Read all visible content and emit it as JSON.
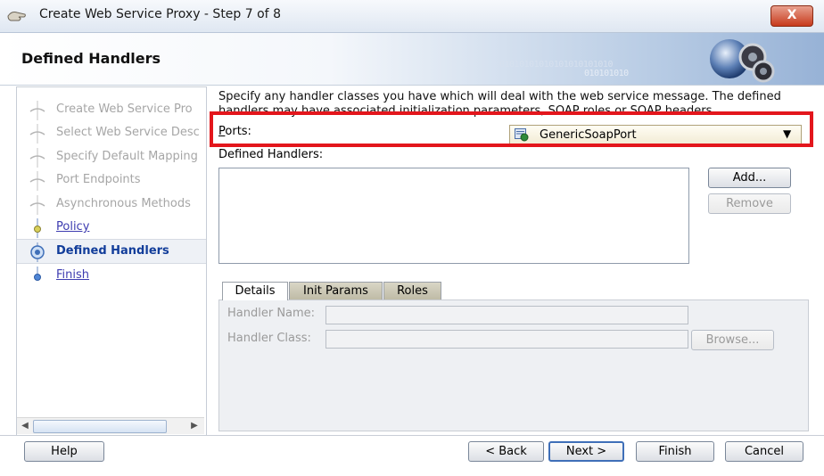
{
  "window": {
    "title": "Create Web Service Proxy - Step 7 of 8",
    "close_label": "X"
  },
  "header": {
    "title": "Defined Handlers",
    "decor_binary_1": "01010101010101010101010",
    "decor_binary_2": "010101010"
  },
  "steps": [
    {
      "label": "Create Web Service Pro",
      "state": "done"
    },
    {
      "label": "Select Web Service Desc",
      "state": "done"
    },
    {
      "label": "Specify Default Mapping",
      "state": "done"
    },
    {
      "label": "Port Endpoints",
      "state": "done"
    },
    {
      "label": "Asynchronous Methods",
      "state": "done"
    },
    {
      "label": "Policy",
      "state": "link"
    },
    {
      "label": "Defined Handlers",
      "state": "current"
    },
    {
      "label": "Finish",
      "state": "link"
    }
  ],
  "main": {
    "instructions": "Specify any handler classes you have which will deal with the web service message. The defined handlers may have associated initialization parameters, SOAP roles or SOAP headers.",
    "ports_label": "Ports:",
    "ports_value": "GenericSoapPort",
    "handlers_label": "Defined Handlers:",
    "add_label": "Add...",
    "remove_label": "Remove"
  },
  "tabs": [
    {
      "label": "Details",
      "active": true
    },
    {
      "label": "Init Params",
      "active": false
    },
    {
      "label": "Roles",
      "active": false
    }
  ],
  "details": {
    "handler_name_label": "Handler Name:",
    "handler_class_label": "Handler Class:",
    "handler_name_value": "",
    "handler_class_value": "",
    "browse_label": "Browse..."
  },
  "footer": {
    "help_label": "Help",
    "back_label": "< Back",
    "next_label": "Next >",
    "finish_label": "Finish",
    "cancel_label": "Cancel"
  },
  "colors": {
    "highlight": "#e3161c",
    "current_step_text": "#123d9a",
    "link_text": "#3d3cb0",
    "disabled_text": "#a6a6a6"
  },
  "icons": {
    "title": "wizard-hand-icon",
    "port": "soap-port-icon",
    "logo": "globe-gears-logo-icon",
    "close": "close-icon"
  }
}
